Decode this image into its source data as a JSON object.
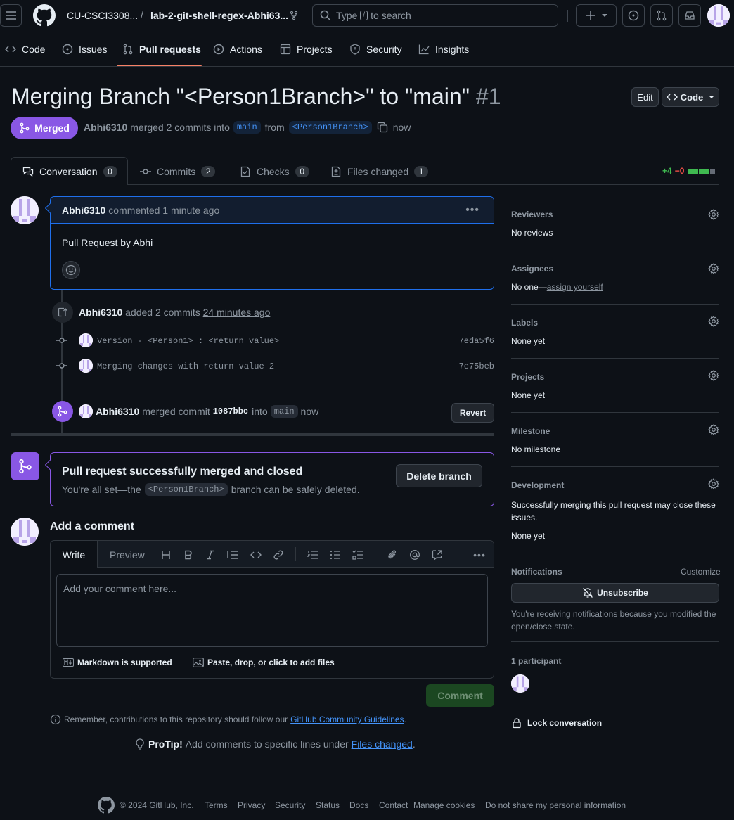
{
  "header": {
    "org": "CU-CSCI3308...",
    "separator": "/",
    "repo": "lab-2-git-shell-regex-Abhi63...",
    "search_placeholder_pre": "Type",
    "search_key": "/",
    "search_placeholder_post": "to search"
  },
  "repo_nav": [
    {
      "label": "Code",
      "icon": "code-icon"
    },
    {
      "label": "Issues",
      "icon": "issue-icon"
    },
    {
      "label": "Pull requests",
      "icon": "pull-request-icon"
    },
    {
      "label": "Actions",
      "icon": "play-icon"
    },
    {
      "label": "Projects",
      "icon": "table-icon"
    },
    {
      "label": "Security",
      "icon": "shield-icon"
    },
    {
      "label": "Insights",
      "icon": "graph-icon"
    }
  ],
  "pr": {
    "title": "Merging Branch \"<Person1Branch>\" to \"main\"",
    "number": "#1",
    "edit_label": "Edit",
    "code_label": "Code",
    "state": "Merged",
    "author": "Abhi6310",
    "merged_text": "merged 2 commits into",
    "base": "main",
    "from_text": "from",
    "head": "<Person1Branch>",
    "time": "now"
  },
  "tabs": [
    {
      "label": "Conversation",
      "count": "0",
      "icon": "comment-discussion-icon"
    },
    {
      "label": "Commits",
      "count": "2",
      "icon": "commit-icon"
    },
    {
      "label": "Checks",
      "count": "0",
      "icon": "checklist-icon"
    },
    {
      "label": "Files changed",
      "count": "1",
      "icon": "file-diff-icon"
    }
  ],
  "diffstat": {
    "additions": "+4",
    "deletions": "−0",
    "colors": [
      "#3fb950",
      "#3fb950",
      "#3fb950",
      "#3fb950",
      "#656c76"
    ]
  },
  "comment": {
    "author": "Abhi6310",
    "meta": "commented 1 minute ago",
    "body": "Pull Request by Abhi"
  },
  "commits_event": {
    "author": "Abhi6310",
    "text": "added 2 commits",
    "time": "24 minutes ago",
    "commits": [
      {
        "message": "Version - <Person1> : <return value>",
        "sha": "7eda5f6"
      },
      {
        "message": "Merging changes with return value 2",
        "sha": "7e75beb"
      }
    ]
  },
  "merge_event": {
    "author": "Abhi6310",
    "text": "merged commit",
    "sha": "1087bbc",
    "into": "into",
    "branch": "main",
    "time": "now",
    "revert_label": "Revert"
  },
  "merged_box": {
    "title": "Pull request successfully merged and closed",
    "pre": "You're all set—the",
    "branch": "<Person1Branch>",
    "post": "branch can be safely deleted.",
    "delete_label": "Delete branch"
  },
  "add_comment": {
    "heading": "Add a comment",
    "write_tab": "Write",
    "preview_tab": "Preview",
    "placeholder": "Add your comment here...",
    "markdown_label": "Markdown is supported",
    "files_label": "Paste, drop, or click to add files",
    "submit_label": "Comment"
  },
  "guidelines": {
    "pre": "Remember, contributions to this repository should follow our",
    "link": "GitHub Community Guidelines",
    "post": "."
  },
  "protip": {
    "label": "ProTip!",
    "text": "Add comments to specific lines under",
    "link": "Files changed",
    "post": "."
  },
  "sidebar": {
    "reviewers_h": "Reviewers",
    "reviewers_v": "No reviews",
    "assignees_h": "Assignees",
    "assignees_v": "No one—",
    "assignees_link": "assign yourself",
    "labels_h": "Labels",
    "labels_v": "None yet",
    "projects_h": "Projects",
    "projects_v": "None yet",
    "milestone_h": "Milestone",
    "milestone_v": "No milestone",
    "development_h": "Development",
    "development_text": "Successfully merging this pull request may close these issues.",
    "development_v": "None yet",
    "notifications_h": "Notifications",
    "customize": "Customize",
    "unsubscribe": "Unsubscribe",
    "notif_reason": "You're receiving notifications because you modified the open/close state.",
    "participants": "1 participant",
    "lock": "Lock conversation"
  },
  "footer": {
    "copyright": "© 2024 GitHub, Inc.",
    "links": [
      "Terms",
      "Privacy",
      "Security",
      "Status",
      "Docs",
      "Contact",
      "Manage cookies",
      "Do not share my personal information"
    ]
  },
  "colors": {
    "merged": "#8957e5",
    "accent": "#4493f8",
    "success_btn": "#238636"
  }
}
